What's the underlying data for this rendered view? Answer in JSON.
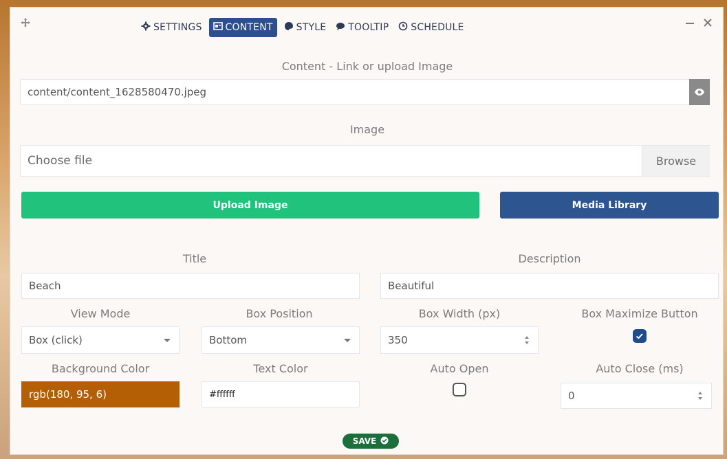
{
  "tabs": {
    "settings": "SETTINGS",
    "content": "CONTENT",
    "style": "STYLE",
    "tooltip": "TOOLTIP",
    "schedule": "SCHEDULE"
  },
  "window_controls": {
    "minimize": "—",
    "close": "×"
  },
  "content_section": {
    "label": "Content - Link or upload Image",
    "link_value": "content/content_1628580470.jpeg"
  },
  "image_section": {
    "label": "Image",
    "file_placeholder": "Choose file",
    "browse_label": "Browse",
    "upload_button": "Upload Image",
    "media_library_button": "Media Library"
  },
  "fields": {
    "title_label": "Title",
    "title_value": "Beach",
    "description_label": "Description",
    "description_value": "Beautiful",
    "view_mode_label": "View Mode",
    "view_mode_value": "Box (click)",
    "box_position_label": "Box Position",
    "box_position_value": "Bottom",
    "box_width_label": "Box Width (px)",
    "box_width_value": "350",
    "box_maximize_label": "Box Maximize Button",
    "box_maximize_checked": true,
    "background_color_label": "Background Color",
    "background_color_value": "rgb(180, 95, 6)",
    "text_color_label": "Text Color",
    "text_color_value": "#ffffff",
    "auto_open_label": "Auto Open",
    "auto_open_checked": false,
    "auto_close_label": "Auto Close (ms)",
    "auto_close_value": "0"
  },
  "save_button": "SAVE",
  "colors": {
    "accent_blue": "#2d4f8e",
    "upload_green": "#21c27c",
    "save_green": "#1a6f3b",
    "background_swatch": "#b45f06"
  }
}
